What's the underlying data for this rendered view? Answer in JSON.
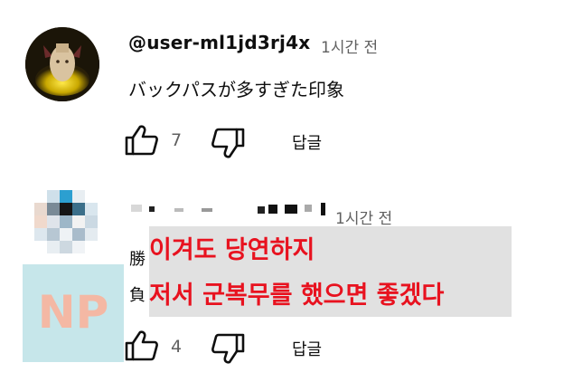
{
  "comments": [
    {
      "author": "@user-ml1jd3rj4x",
      "time": "1시간 전",
      "text": "バックパスが多すぎた印象",
      "likes": "7",
      "reply_label": "답글"
    },
    {
      "author": "",
      "time": "1시간 전",
      "text_line1_visible": "勝",
      "text_line2_visible": "負",
      "likes": "4",
      "reply_label": "답글"
    }
  ],
  "overlay": {
    "line1": "이겨도 당연하지",
    "line2": "저서 군복무를 했으면 좋겠다"
  },
  "badge": {
    "label": "NP"
  },
  "colors": {
    "overlay_text": "#e8121f",
    "overlay_bg": "#e1e1e1",
    "badge_bg": "#c6e6ea",
    "badge_text": "#f4b8a4",
    "secondary_text": "#606060"
  },
  "icons": [
    "like-icon",
    "dislike-icon"
  ]
}
